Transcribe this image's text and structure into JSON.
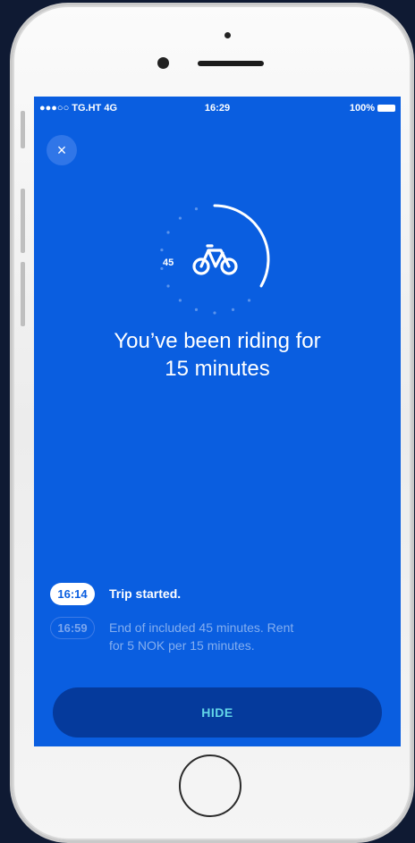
{
  "status_bar": {
    "carrier": "●●●○○ TG.HT  4G",
    "time": "16:29",
    "battery": "100%"
  },
  "close_label": "×",
  "timer": {
    "label": "45",
    "elapsed_fraction": 0.333
  },
  "headline": {
    "line1": "You’ve been riding for",
    "line2": "15 minutes"
  },
  "timeline": {
    "items": [
      {
        "time": "16:14",
        "text": "Trip started."
      },
      {
        "time": "16:59",
        "text_line1": "End of included 45 minutes. Rent",
        "text_line2": "for 5 NOK per 15 minutes."
      }
    ]
  },
  "hide_label": "HIDE",
  "colors": {
    "screen_bg": "#0a5ee0",
    "hide_button_bg": "#053a9c",
    "hide_button_text": "#63d6e8"
  },
  "icons": [
    "close-icon",
    "bike-icon",
    "battery-icon"
  ]
}
